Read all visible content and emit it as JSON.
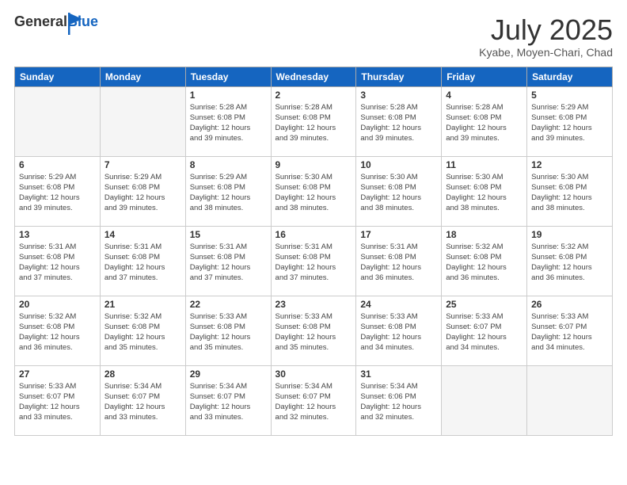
{
  "logo": {
    "general": "General",
    "blue": "Blue"
  },
  "header": {
    "month": "July 2025",
    "location": "Kyabe, Moyen-Chari, Chad"
  },
  "weekdays": [
    "Sunday",
    "Monday",
    "Tuesday",
    "Wednesday",
    "Thursday",
    "Friday",
    "Saturday"
  ],
  "weeks": [
    [
      {
        "day": "",
        "empty": true
      },
      {
        "day": "",
        "empty": true
      },
      {
        "day": "1",
        "sunrise": "5:28 AM",
        "sunset": "6:08 PM",
        "daylight": "12 hours and 39 minutes."
      },
      {
        "day": "2",
        "sunrise": "5:28 AM",
        "sunset": "6:08 PM",
        "daylight": "12 hours and 39 minutes."
      },
      {
        "day": "3",
        "sunrise": "5:28 AM",
        "sunset": "6:08 PM",
        "daylight": "12 hours and 39 minutes."
      },
      {
        "day": "4",
        "sunrise": "5:28 AM",
        "sunset": "6:08 PM",
        "daylight": "12 hours and 39 minutes."
      },
      {
        "day": "5",
        "sunrise": "5:29 AM",
        "sunset": "6:08 PM",
        "daylight": "12 hours and 39 minutes."
      }
    ],
    [
      {
        "day": "6",
        "sunrise": "5:29 AM",
        "sunset": "6:08 PM",
        "daylight": "12 hours and 39 minutes."
      },
      {
        "day": "7",
        "sunrise": "5:29 AM",
        "sunset": "6:08 PM",
        "daylight": "12 hours and 39 minutes."
      },
      {
        "day": "8",
        "sunrise": "5:29 AM",
        "sunset": "6:08 PM",
        "daylight": "12 hours and 38 minutes."
      },
      {
        "day": "9",
        "sunrise": "5:30 AM",
        "sunset": "6:08 PM",
        "daylight": "12 hours and 38 minutes."
      },
      {
        "day": "10",
        "sunrise": "5:30 AM",
        "sunset": "6:08 PM",
        "daylight": "12 hours and 38 minutes."
      },
      {
        "day": "11",
        "sunrise": "5:30 AM",
        "sunset": "6:08 PM",
        "daylight": "12 hours and 38 minutes."
      },
      {
        "day": "12",
        "sunrise": "5:30 AM",
        "sunset": "6:08 PM",
        "daylight": "12 hours and 38 minutes."
      }
    ],
    [
      {
        "day": "13",
        "sunrise": "5:31 AM",
        "sunset": "6:08 PM",
        "daylight": "12 hours and 37 minutes."
      },
      {
        "day": "14",
        "sunrise": "5:31 AM",
        "sunset": "6:08 PM",
        "daylight": "12 hours and 37 minutes."
      },
      {
        "day": "15",
        "sunrise": "5:31 AM",
        "sunset": "6:08 PM",
        "daylight": "12 hours and 37 minutes."
      },
      {
        "day": "16",
        "sunrise": "5:31 AM",
        "sunset": "6:08 PM",
        "daylight": "12 hours and 37 minutes."
      },
      {
        "day": "17",
        "sunrise": "5:31 AM",
        "sunset": "6:08 PM",
        "daylight": "12 hours and 36 minutes."
      },
      {
        "day": "18",
        "sunrise": "5:32 AM",
        "sunset": "6:08 PM",
        "daylight": "12 hours and 36 minutes."
      },
      {
        "day": "19",
        "sunrise": "5:32 AM",
        "sunset": "6:08 PM",
        "daylight": "12 hours and 36 minutes."
      }
    ],
    [
      {
        "day": "20",
        "sunrise": "5:32 AM",
        "sunset": "6:08 PM",
        "daylight": "12 hours and 36 minutes."
      },
      {
        "day": "21",
        "sunrise": "5:32 AM",
        "sunset": "6:08 PM",
        "daylight": "12 hours and 35 minutes."
      },
      {
        "day": "22",
        "sunrise": "5:33 AM",
        "sunset": "6:08 PM",
        "daylight": "12 hours and 35 minutes."
      },
      {
        "day": "23",
        "sunrise": "5:33 AM",
        "sunset": "6:08 PM",
        "daylight": "12 hours and 35 minutes."
      },
      {
        "day": "24",
        "sunrise": "5:33 AM",
        "sunset": "6:08 PM",
        "daylight": "12 hours and 34 minutes."
      },
      {
        "day": "25",
        "sunrise": "5:33 AM",
        "sunset": "6:07 PM",
        "daylight": "12 hours and 34 minutes."
      },
      {
        "day": "26",
        "sunrise": "5:33 AM",
        "sunset": "6:07 PM",
        "daylight": "12 hours and 34 minutes."
      }
    ],
    [
      {
        "day": "27",
        "sunrise": "5:33 AM",
        "sunset": "6:07 PM",
        "daylight": "12 hours and 33 minutes."
      },
      {
        "day": "28",
        "sunrise": "5:34 AM",
        "sunset": "6:07 PM",
        "daylight": "12 hours and 33 minutes."
      },
      {
        "day": "29",
        "sunrise": "5:34 AM",
        "sunset": "6:07 PM",
        "daylight": "12 hours and 33 minutes."
      },
      {
        "day": "30",
        "sunrise": "5:34 AM",
        "sunset": "6:07 PM",
        "daylight": "12 hours and 32 minutes."
      },
      {
        "day": "31",
        "sunrise": "5:34 AM",
        "sunset": "6:06 PM",
        "daylight": "12 hours and 32 minutes."
      },
      {
        "day": "",
        "empty": true
      },
      {
        "day": "",
        "empty": true
      }
    ]
  ],
  "labels": {
    "sunrise": "Sunrise:",
    "sunset": "Sunset:",
    "daylight": "Daylight:"
  }
}
